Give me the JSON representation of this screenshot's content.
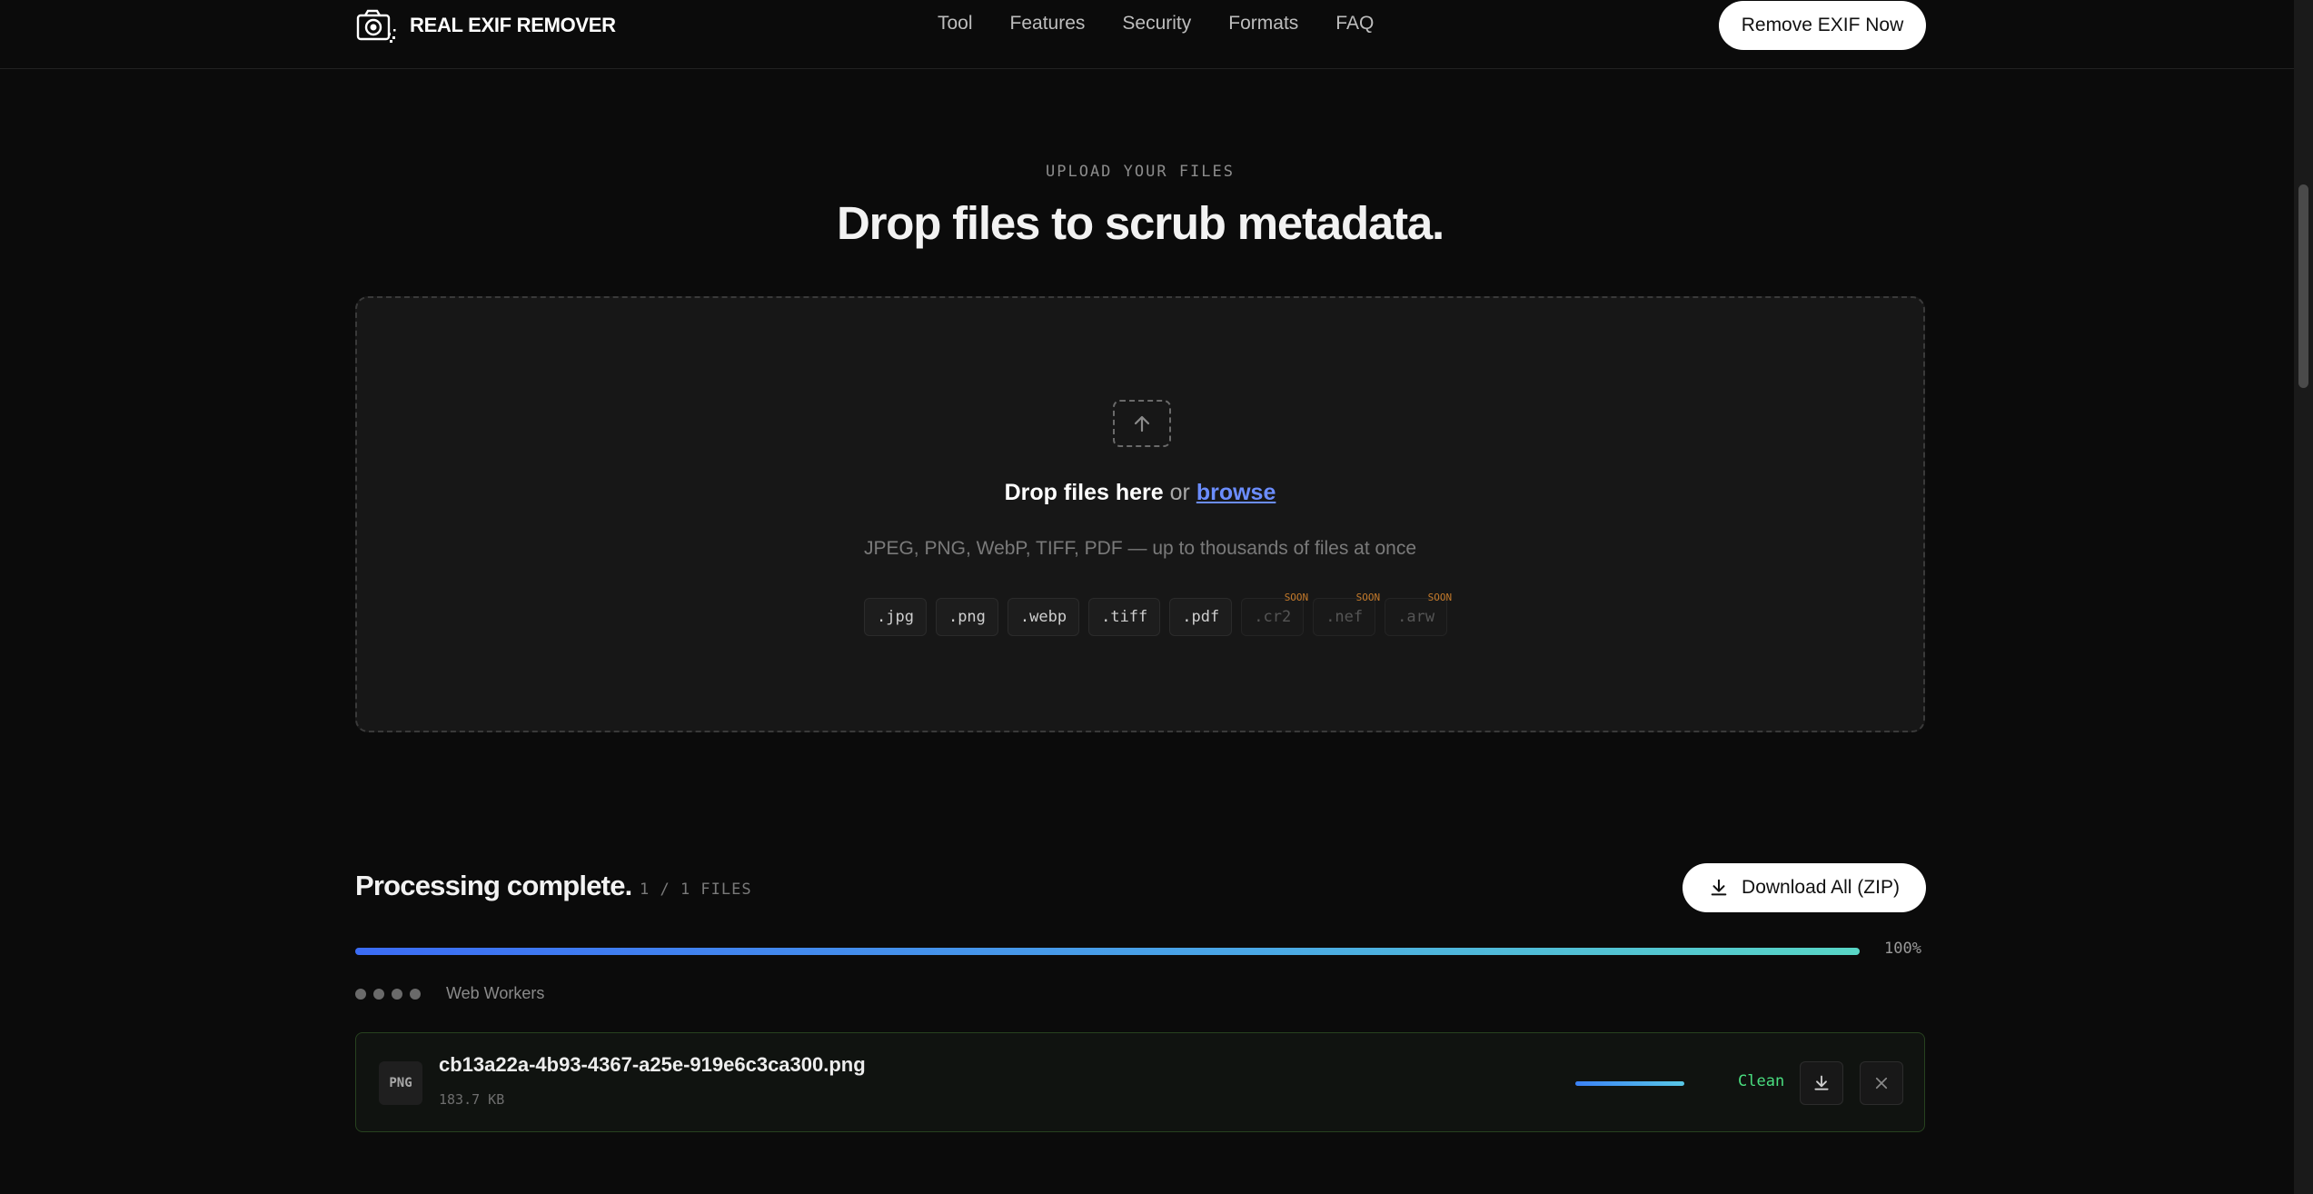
{
  "header": {
    "brand": "REAL EXIF REMOVER",
    "brand_icon": "camera-icon",
    "nav": [
      "Tool",
      "Features",
      "Security",
      "Formats",
      "FAQ"
    ],
    "cta_label": "Remove EXIF Now"
  },
  "hero": {
    "eyebrow": "UPLOAD YOUR FILES",
    "title": "Drop files to scrub metadata."
  },
  "dropzone": {
    "icon": "upload-arrow-icon",
    "drop_text": "Drop files here",
    "or_text": "or",
    "browse_label": "browse",
    "support_text": "JPEG, PNG, WebP, TIFF, PDF — up to thousands of files at once",
    "formats": [
      ".jpg",
      ".png",
      ".webp",
      ".tiff",
      ".pdf"
    ],
    "soon_formats": [
      ".cr2",
      ".nef",
      ".arw"
    ],
    "soon_label": "SOON"
  },
  "processing": {
    "title": "Processing complete.",
    "count": "1 / 1 FILES",
    "zip_label": "Download All (ZIP)",
    "progress_value": 1.0,
    "progress_text": "100%",
    "workers_label": "Web Workers",
    "worker_count": 4
  },
  "files": [
    {
      "type": "PNG",
      "name": "cb13a22a-4b93-4367-a25e-919e6c3ca300.png",
      "size": "183.7 KB",
      "progress": 1.0,
      "status": "Clean",
      "status_color": "#4ade80"
    }
  ],
  "colors": {
    "background": "#0b0b0b",
    "accent_link": "#6b8dff",
    "progress_start": "#3b6cf5",
    "progress_end": "#58d6c6",
    "soon_tag": "#c47a2b"
  }
}
